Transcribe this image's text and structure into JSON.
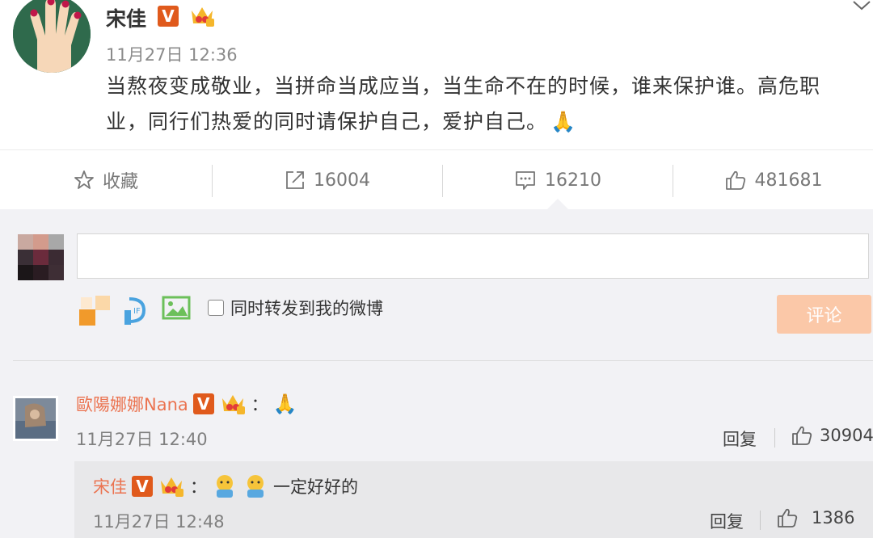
{
  "post": {
    "author": "宋佳",
    "time": "11月27日 12:36",
    "text_line1": "当熬夜变成敬业，当拼命当成应当，当生命不在的时候，谁来保护谁。高危职",
    "text_line2": "业，同行们热爱的同时请保护自己，爱护自己。",
    "emoji": "🙏"
  },
  "actions": {
    "favorite_label": "收藏",
    "repost_count": "16004",
    "comment_count": "16210",
    "like_count": "481681"
  },
  "composer": {
    "placeholder": "",
    "repost_checkbox_label": "同时转发到我的微博",
    "submit_label": "评论"
  },
  "comment": {
    "author": "歐陽娜娜Nana",
    "colon": "：",
    "emoji": "🙏",
    "time": "11月27日 12:40",
    "reply_label": "回复",
    "like_count": "30904"
  },
  "reply": {
    "author": "宋佳",
    "colon": "：",
    "text": "一定好好的",
    "time": "11月27日 12:48",
    "reply_label": "回复",
    "like_count": "1386"
  },
  "colors": {
    "accent_name": "#eb7350",
    "verified": "#e05a1c",
    "button_disabled": "#fbc8a8"
  }
}
